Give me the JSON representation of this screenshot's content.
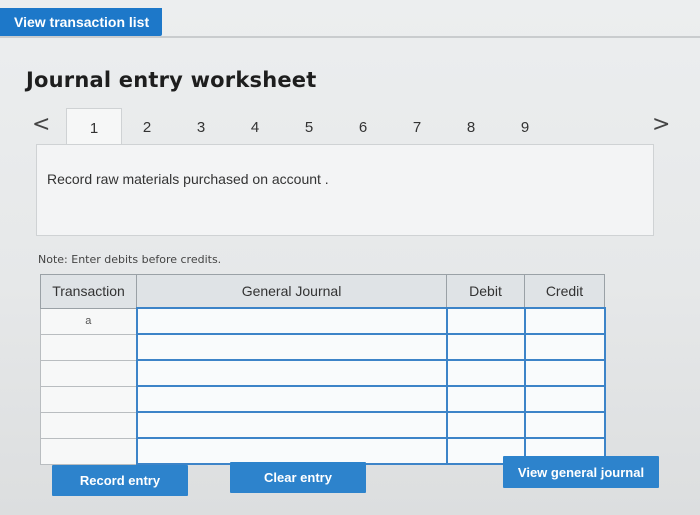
{
  "header": {
    "view_transaction_list_label": "View transaction list"
  },
  "worksheet": {
    "title": "Journal entry worksheet",
    "tabs": [
      "1",
      "2",
      "3",
      "4",
      "5",
      "6",
      "7",
      "8",
      "9"
    ],
    "active_tab": "1",
    "prev_arrow": "<",
    "next_arrow": ">",
    "instruction": "Record raw materials purchased on account ."
  },
  "note": "Note: Enter debits before credits.",
  "table": {
    "headers": {
      "transaction": "Transaction",
      "general_journal": "General Journal",
      "debit": "Debit",
      "credit": "Credit"
    },
    "rows": [
      {
        "transaction": "a",
        "account": "",
        "debit": "",
        "credit": ""
      },
      {
        "transaction": "",
        "account": "",
        "debit": "",
        "credit": ""
      },
      {
        "transaction": "",
        "account": "",
        "debit": "",
        "credit": ""
      },
      {
        "transaction": "",
        "account": "",
        "debit": "",
        "credit": ""
      },
      {
        "transaction": "",
        "account": "",
        "debit": "",
        "credit": ""
      },
      {
        "transaction": "",
        "account": "",
        "debit": "",
        "credit": ""
      }
    ]
  },
  "buttons": {
    "record_entry": "Record entry",
    "clear_entry": "Clear entry",
    "view_general_journal": "View general journal"
  },
  "colors": {
    "primary": "#2d83cc",
    "input_border": "#3d84c8"
  }
}
